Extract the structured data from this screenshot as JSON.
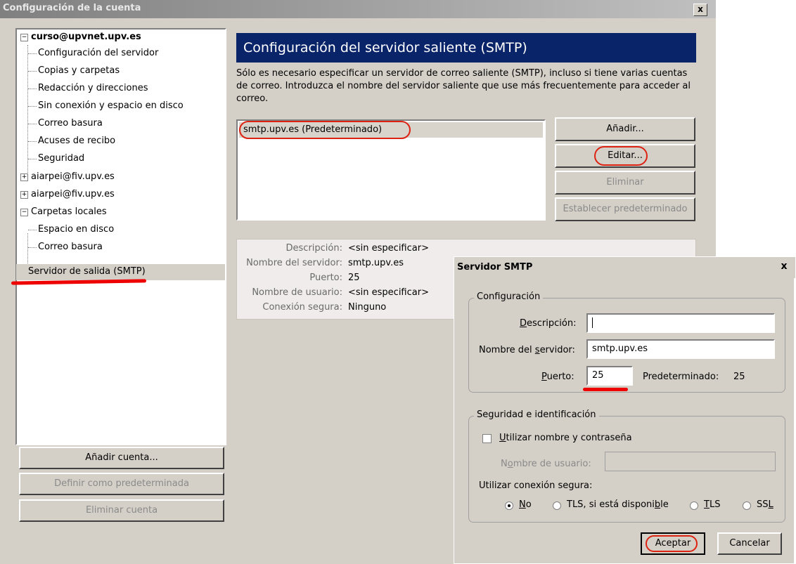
{
  "main_window": {
    "title": "Configuración de la cuenta",
    "close_label": "x"
  },
  "tree": {
    "account1": "curso@upvnet.upv.es",
    "account1_children": [
      "Configuración del servidor",
      "Copias y carpetas",
      "Redacción y direcciones",
      "Sin conexión y espacio en disco",
      "Correo basura",
      "Acuses de recibo",
      "Seguridad"
    ],
    "account2": "aiarpei@fiv.upv.es",
    "account3": "aiarpei@fiv.upv.es",
    "local": "Carpetas locales",
    "local_children": [
      "Espacio en disco",
      "Correo basura"
    ],
    "smtp": "Servidor de salida (SMTP)"
  },
  "left_buttons": {
    "add_account": "Añadir cuenta...",
    "set_default": "Definir como predeterminada",
    "delete_account": "Eliminar cuenta"
  },
  "panel": {
    "heading": "Configuración del servidor saliente (SMTP)",
    "description": "Sólo es necesario especificar un servidor de correo saliente (SMTP), incluso si tiene varias cuentas de correo. Introduzca el nombre del servidor saliente que use más frecuentemente para acceder al correo.",
    "servers": [
      "smtp.upv.es (Predeterminado)"
    ],
    "buttons": {
      "add": "Añadir...",
      "edit": "Editar...",
      "remove": "Eliminar",
      "set_default": "Establecer predeterminado"
    },
    "details": [
      {
        "label": "Descripción:",
        "value": "<sin especificar>"
      },
      {
        "label": "Nombre del servidor:",
        "value": "smtp.upv.es"
      },
      {
        "label": "Puerto:",
        "value": "25"
      },
      {
        "label": "Nombre de usuario:",
        "value": "<sin especificar>"
      },
      {
        "label": "Conexión segura:",
        "value": "Ninguno"
      }
    ]
  },
  "dialog": {
    "title": "Servidor SMTP",
    "close_label": "x",
    "config_group": "Configuración",
    "desc_label": "Descripción:",
    "desc_value": "",
    "server_label": "Nombre del servidor:",
    "server_value": "smtp.upv.es",
    "port_label": "Puerto:",
    "port_value": "25",
    "default_port_label": "Predeterminado:",
    "default_port_value": "25",
    "security_group": "Seguridad e identificación",
    "use_auth_label": "Utilizar nombre y contraseña",
    "use_auth_checked": false,
    "username_label": "Nombre de usuario:",
    "username_value": "",
    "secure_conn_label": "Utilizar conexión segura:",
    "radio_options": [
      "No",
      "TLS, si está disponible",
      "TLS",
      "SSL"
    ],
    "radio_selected": "No",
    "ok": "Aceptar",
    "cancel": "Cancelar"
  },
  "colors": {
    "header_bg": "#0a246a",
    "window_bg": "#d4d0c8",
    "highlight_ring": "#dd2211"
  }
}
